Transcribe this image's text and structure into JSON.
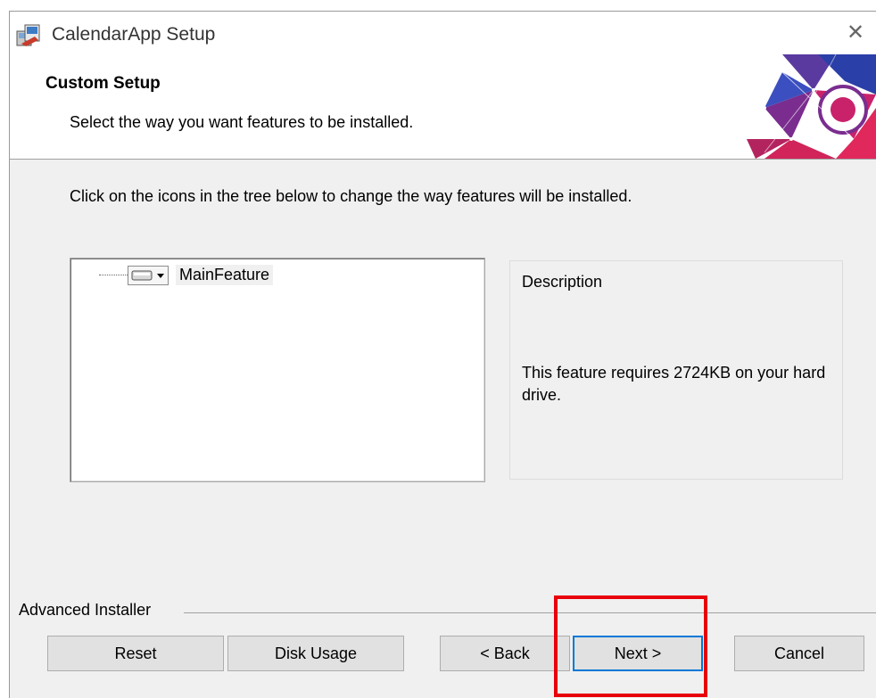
{
  "window": {
    "title": "CalendarApp Setup",
    "close_glyph": "✕"
  },
  "header": {
    "title": "Custom Setup",
    "subtitle": "Select the way you want features to be installed."
  },
  "body": {
    "instructions": "Click on the icons in the tree below to change the way features will be installed."
  },
  "tree": {
    "items": [
      {
        "label": "MainFeature",
        "icon": "drive-icon"
      }
    ]
  },
  "description": {
    "title": "Description",
    "text": "This feature requires 2724KB on your hard drive."
  },
  "footer": {
    "group_label": "Advanced Installer",
    "buttons": {
      "reset": "Reset",
      "disk_usage": "Disk Usage",
      "back": "< Back",
      "next": "Next >",
      "cancel": "Cancel"
    }
  },
  "colors": {
    "accent": "#0078d7",
    "highlight": "#e8000b",
    "dialog_bg": "#f0f0f0"
  }
}
